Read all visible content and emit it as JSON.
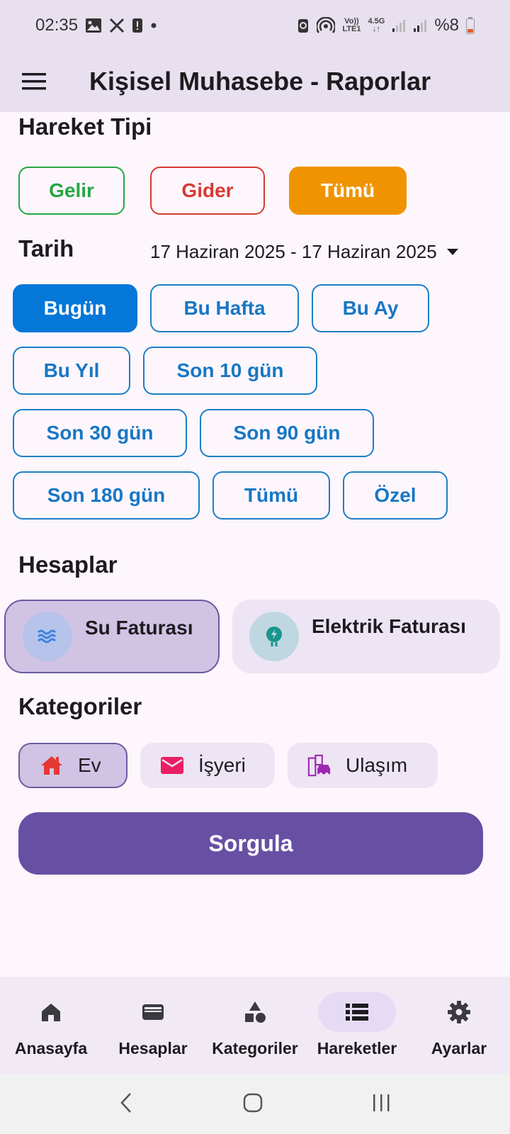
{
  "status_bar": {
    "time": "02:35",
    "volte_top": "Vo))",
    "volte_bottom": "LTE1",
    "net_type": "4.5G",
    "battery": "%8"
  },
  "app_bar": {
    "title": "Kişisel Muhasebe - Raporlar"
  },
  "transaction_type": {
    "title": "Hareket Tipi",
    "options": [
      "Gelir",
      "Gider",
      "Tümü"
    ],
    "selected": "Tümü",
    "colors": {
      "income": "#25a744",
      "expense": "#d73a33",
      "all": "#ef9400"
    }
  },
  "date": {
    "title": "Tarih",
    "range": "17 Haziran 2025 - 17 Haziran 2025",
    "options": [
      "Bugün",
      "Bu Hafta",
      "Bu Ay",
      "Bu Yıl",
      "Son 10 gün",
      "Son 30 gün",
      "Son 90 gün",
      "Son 180 gün",
      "Tümü",
      "Özel"
    ],
    "selected": "Bugün"
  },
  "accounts": {
    "title": "Hesaplar",
    "items": [
      {
        "label": "Su Faturası",
        "icon": "water-icon",
        "selected": true
      },
      {
        "label": "Elektrik Faturası",
        "icon": "ev-charger-icon",
        "selected": false
      }
    ]
  },
  "categories": {
    "title": "Kategoriler",
    "items": [
      {
        "label": "Ev",
        "icon": "home-icon",
        "selected": true
      },
      {
        "label": "İşyeri",
        "icon": "mail-icon",
        "selected": false
      },
      {
        "label": "Ulaşım",
        "icon": "city-car-icon",
        "selected": false
      }
    ]
  },
  "submit_label": "Sorgula",
  "bottom_nav": {
    "items": [
      {
        "label": "Anasayfa",
        "icon": "home-icon"
      },
      {
        "label": "Hesaplar",
        "icon": "wallet-icon"
      },
      {
        "label": "Kategoriler",
        "icon": "shapes-icon"
      },
      {
        "label": "Hareketler",
        "icon": "list-icon"
      },
      {
        "label": "Ayarlar",
        "icon": "gear-icon"
      }
    ],
    "active": "Hareketler"
  },
  "theme": {
    "primary": "#6750a4",
    "date_accent": "#1877c4",
    "selected_date": "#0577d8"
  }
}
